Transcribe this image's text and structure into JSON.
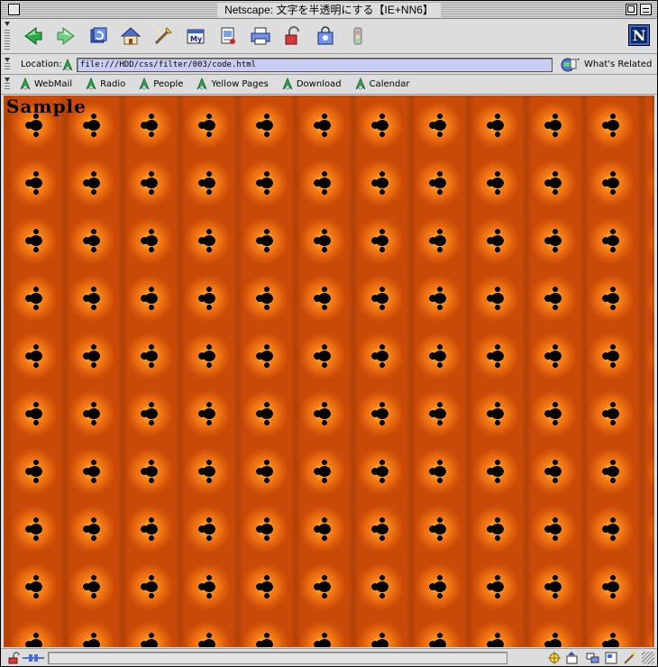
{
  "window": {
    "title": "Netscape: 文字を半透明にする【IE+NN6】"
  },
  "toolbar": {
    "buttons": [
      {
        "name": "back-button",
        "icon": "back-arrow-icon"
      },
      {
        "name": "forward-button",
        "icon": "forward-arrow-icon"
      },
      {
        "name": "reload-button",
        "icon": "reload-icon"
      },
      {
        "name": "home-button",
        "icon": "home-icon"
      },
      {
        "name": "search-button",
        "icon": "search-icon"
      },
      {
        "name": "my-netscape-button",
        "icon": "my-netscape-icon"
      },
      {
        "name": "images-button",
        "icon": "images-icon"
      },
      {
        "name": "print-button",
        "icon": "print-icon"
      },
      {
        "name": "security-button",
        "icon": "lock-icon"
      },
      {
        "name": "shop-button",
        "icon": "shop-icon"
      },
      {
        "name": "stop-button",
        "icon": "stop-icon"
      }
    ],
    "logo_letter": "N"
  },
  "location": {
    "label": "Location:",
    "url": "file:///HDD/css/filter/003/code.html",
    "related_label": "What's Related"
  },
  "personal_toolbar": {
    "items": [
      "WebMail",
      "Radio",
      "People",
      "Yellow Pages",
      "Download",
      "Calendar"
    ]
  },
  "content": {
    "text": "Sample"
  },
  "colors": {
    "content_background": "#c94a08",
    "url_field": "#c9cdf5",
    "chrome": "#dddddd"
  }
}
